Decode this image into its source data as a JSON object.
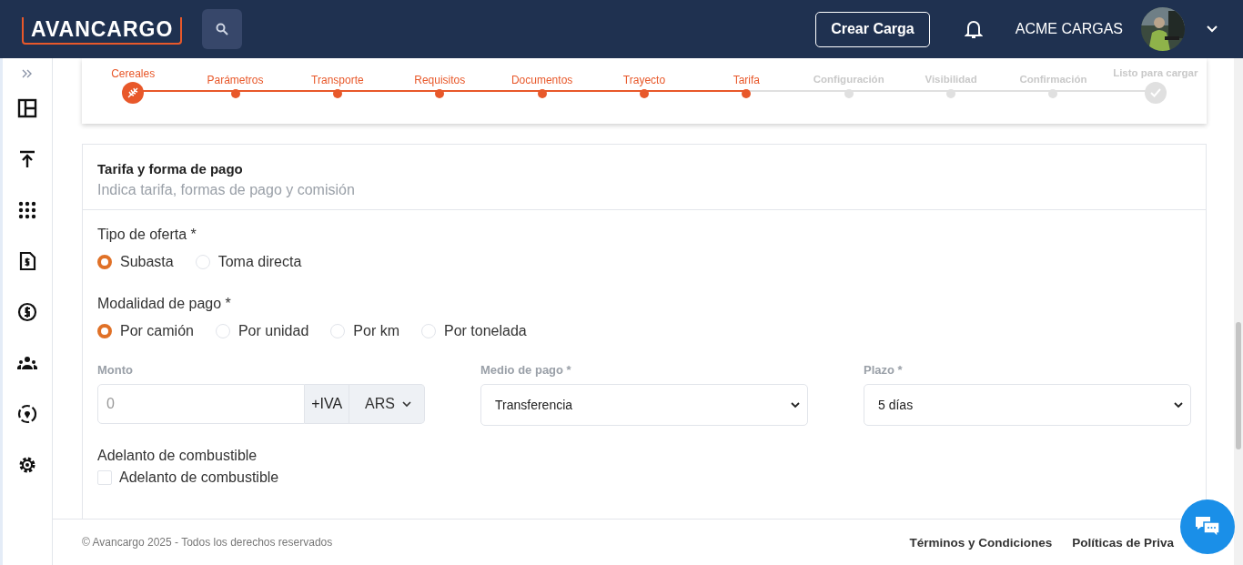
{
  "header": {
    "logo": "AVANCARGO",
    "create_button": "Crear Carga",
    "user_name": "ACME CARGAS"
  },
  "stepper": [
    {
      "label": "Cereales",
      "kind": "start",
      "completed": true
    },
    {
      "label": "Parámetros",
      "kind": "step",
      "completed": true
    },
    {
      "label": "Transporte",
      "kind": "step",
      "completed": true
    },
    {
      "label": "Requisitos",
      "kind": "step",
      "completed": true
    },
    {
      "label": "Documentos",
      "kind": "step",
      "completed": true
    },
    {
      "label": "Trayecto",
      "kind": "step",
      "completed": true
    },
    {
      "label": "Tarifa",
      "kind": "step",
      "completed": true
    },
    {
      "label": "Configuración",
      "kind": "step",
      "completed": false
    },
    {
      "label": "Visibilidad",
      "kind": "step",
      "completed": false
    },
    {
      "label": "Confirmación",
      "kind": "step",
      "completed": false
    },
    {
      "label": "Listo para cargar",
      "kind": "end",
      "completed": false
    }
  ],
  "form": {
    "title": "Tarifa y forma de pago",
    "subtitle": "Indica tarifa, formas de pago y comisión",
    "offer_type": {
      "label": "Tipo de oferta *",
      "options": [
        {
          "label": "Subasta",
          "selected": true
        },
        {
          "label": "Toma directa",
          "selected": false
        }
      ]
    },
    "payment_mode": {
      "label": "Modalidad de pago *",
      "options": [
        {
          "label": "Por camión",
          "selected": true
        },
        {
          "label": "Por unidad",
          "selected": false
        },
        {
          "label": "Por km",
          "selected": false
        },
        {
          "label": "Por tonelada",
          "selected": false
        }
      ]
    },
    "amount": {
      "label": "Monto",
      "placeholder": "0",
      "suffix": "+IVA",
      "currency": "ARS"
    },
    "payment_method": {
      "label": "Medio de pago *",
      "value": "Transferencia"
    },
    "term": {
      "label": "Plazo *",
      "value": "5 días"
    },
    "fuel_advance": {
      "label": "Adelanto de combustible",
      "checkbox_label": "Adelanto de combustible",
      "checked": false
    }
  },
  "footer": {
    "copyright": "© Avancargo 2025 - Todos los derechos reservados",
    "links": [
      "Términos y Condiciones",
      "Políticas de Priva"
    ]
  }
}
